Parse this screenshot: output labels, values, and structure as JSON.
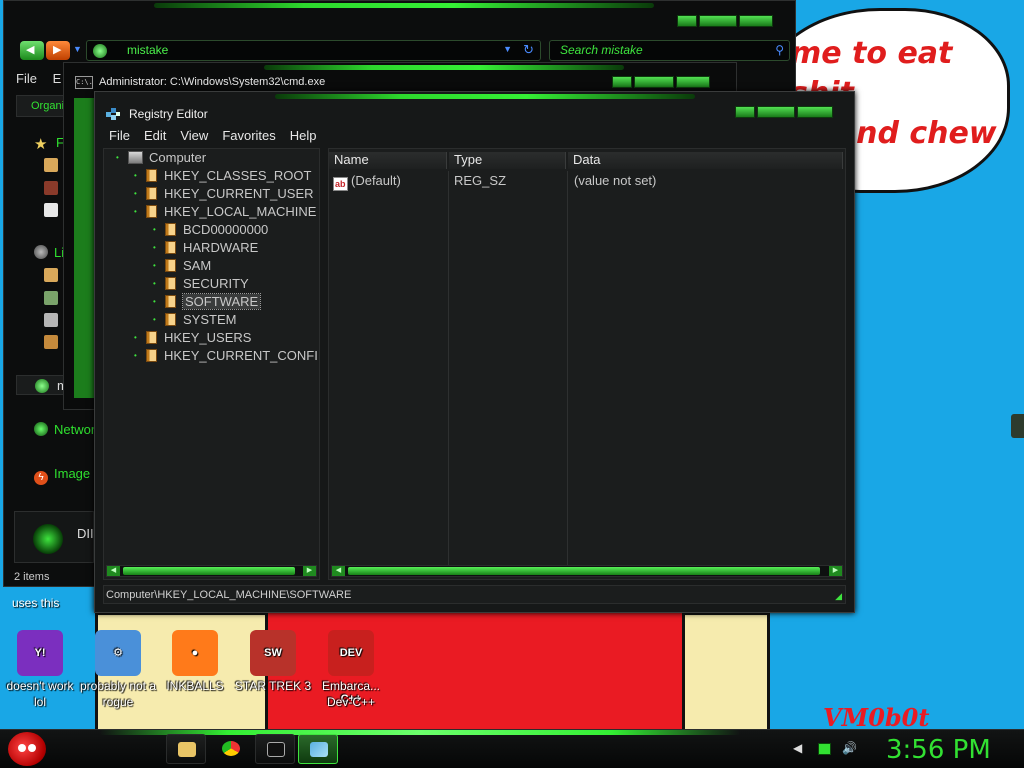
{
  "wallpaper": {
    "bubble_text": "me to eat shit\n or and chew\n em",
    "signature": "VM0b0t"
  },
  "explorer": {
    "address": "mistake",
    "search_placeholder": "Search mistake",
    "menu": [
      "File",
      "E"
    ],
    "toolbar_first": "Organi",
    "sidebar": [
      {
        "label": "F",
        "icon": "star-icon"
      },
      {
        "label": "Li",
        "icon": "library-icon"
      },
      {
        "label": "m",
        "icon": "homegroup-icon"
      },
      {
        "label": "Networ",
        "icon": "network-icon"
      },
      {
        "label": "Image",
        "icon": "flash-icon"
      },
      {
        "label": "DII",
        "icon": "disc-icon"
      }
    ],
    "status": "2 items"
  },
  "cmd": {
    "title": "Administrator: C:\\Windows\\System32\\cmd.exe",
    "icon_text": "C:\\."
  },
  "regedit": {
    "title": "Registry Editor",
    "menu": [
      "File",
      "Edit",
      "View",
      "Favorites",
      "Help"
    ],
    "tree": [
      {
        "label": "Computer",
        "level": 0,
        "kind": "computer"
      },
      {
        "label": "HKEY_CLASSES_ROOT",
        "level": 1,
        "kind": "folder"
      },
      {
        "label": "HKEY_CURRENT_USER",
        "level": 1,
        "kind": "folder"
      },
      {
        "label": "HKEY_LOCAL_MACHINE",
        "level": 1,
        "kind": "folder"
      },
      {
        "label": "BCD00000000",
        "level": 2,
        "kind": "folder"
      },
      {
        "label": "HARDWARE",
        "level": 2,
        "kind": "folder"
      },
      {
        "label": "SAM",
        "level": 2,
        "kind": "folder"
      },
      {
        "label": "SECURITY",
        "level": 2,
        "kind": "folder"
      },
      {
        "label": "SOFTWARE",
        "level": 2,
        "kind": "folder",
        "selected": true
      },
      {
        "label": "SYSTEM",
        "level": 2,
        "kind": "folder"
      },
      {
        "label": "HKEY_USERS",
        "level": 1,
        "kind": "folder"
      },
      {
        "label": "HKEY_CURRENT_CONFI",
        "level": 1,
        "kind": "folder"
      }
    ],
    "columns": [
      "Name",
      "Type",
      "Data"
    ],
    "values": [
      {
        "name": "(Default)",
        "type": "REG_SZ",
        "data": "(value not set)",
        "icon": "ab"
      }
    ],
    "status_path": "Computer\\HKEY_LOCAL_MACHINE\\SOFTWARE"
  },
  "desktop": {
    "caption_top": "uses this",
    "icons": [
      {
        "label": "doesn't work lol",
        "color": "#7b2fbf",
        "glyph": "Y!"
      },
      {
        "label": "probably not a rogue",
        "color": "#4a90d9",
        "glyph": "⚙"
      },
      {
        "label": "INKBALLS",
        "color": "#ff7a1a",
        "glyph": "●"
      },
      {
        "label": "STAR TREK 3",
        "color": "#b8322a",
        "glyph": "SW"
      },
      {
        "label": "Embarca... Dev-C++",
        "color": "#c8201e",
        "glyph": "DEV C++"
      }
    ]
  },
  "taskbar": {
    "clock": "3:56 PM",
    "buttons": [
      "explorer-task",
      "chrome-task",
      "cmd-task",
      "regedit-task"
    ],
    "active_button": "regedit-task"
  },
  "colors": {
    "accent_green": "#32e132",
    "window_bg": "#161818",
    "desktop_blue": "#19a7e6"
  }
}
